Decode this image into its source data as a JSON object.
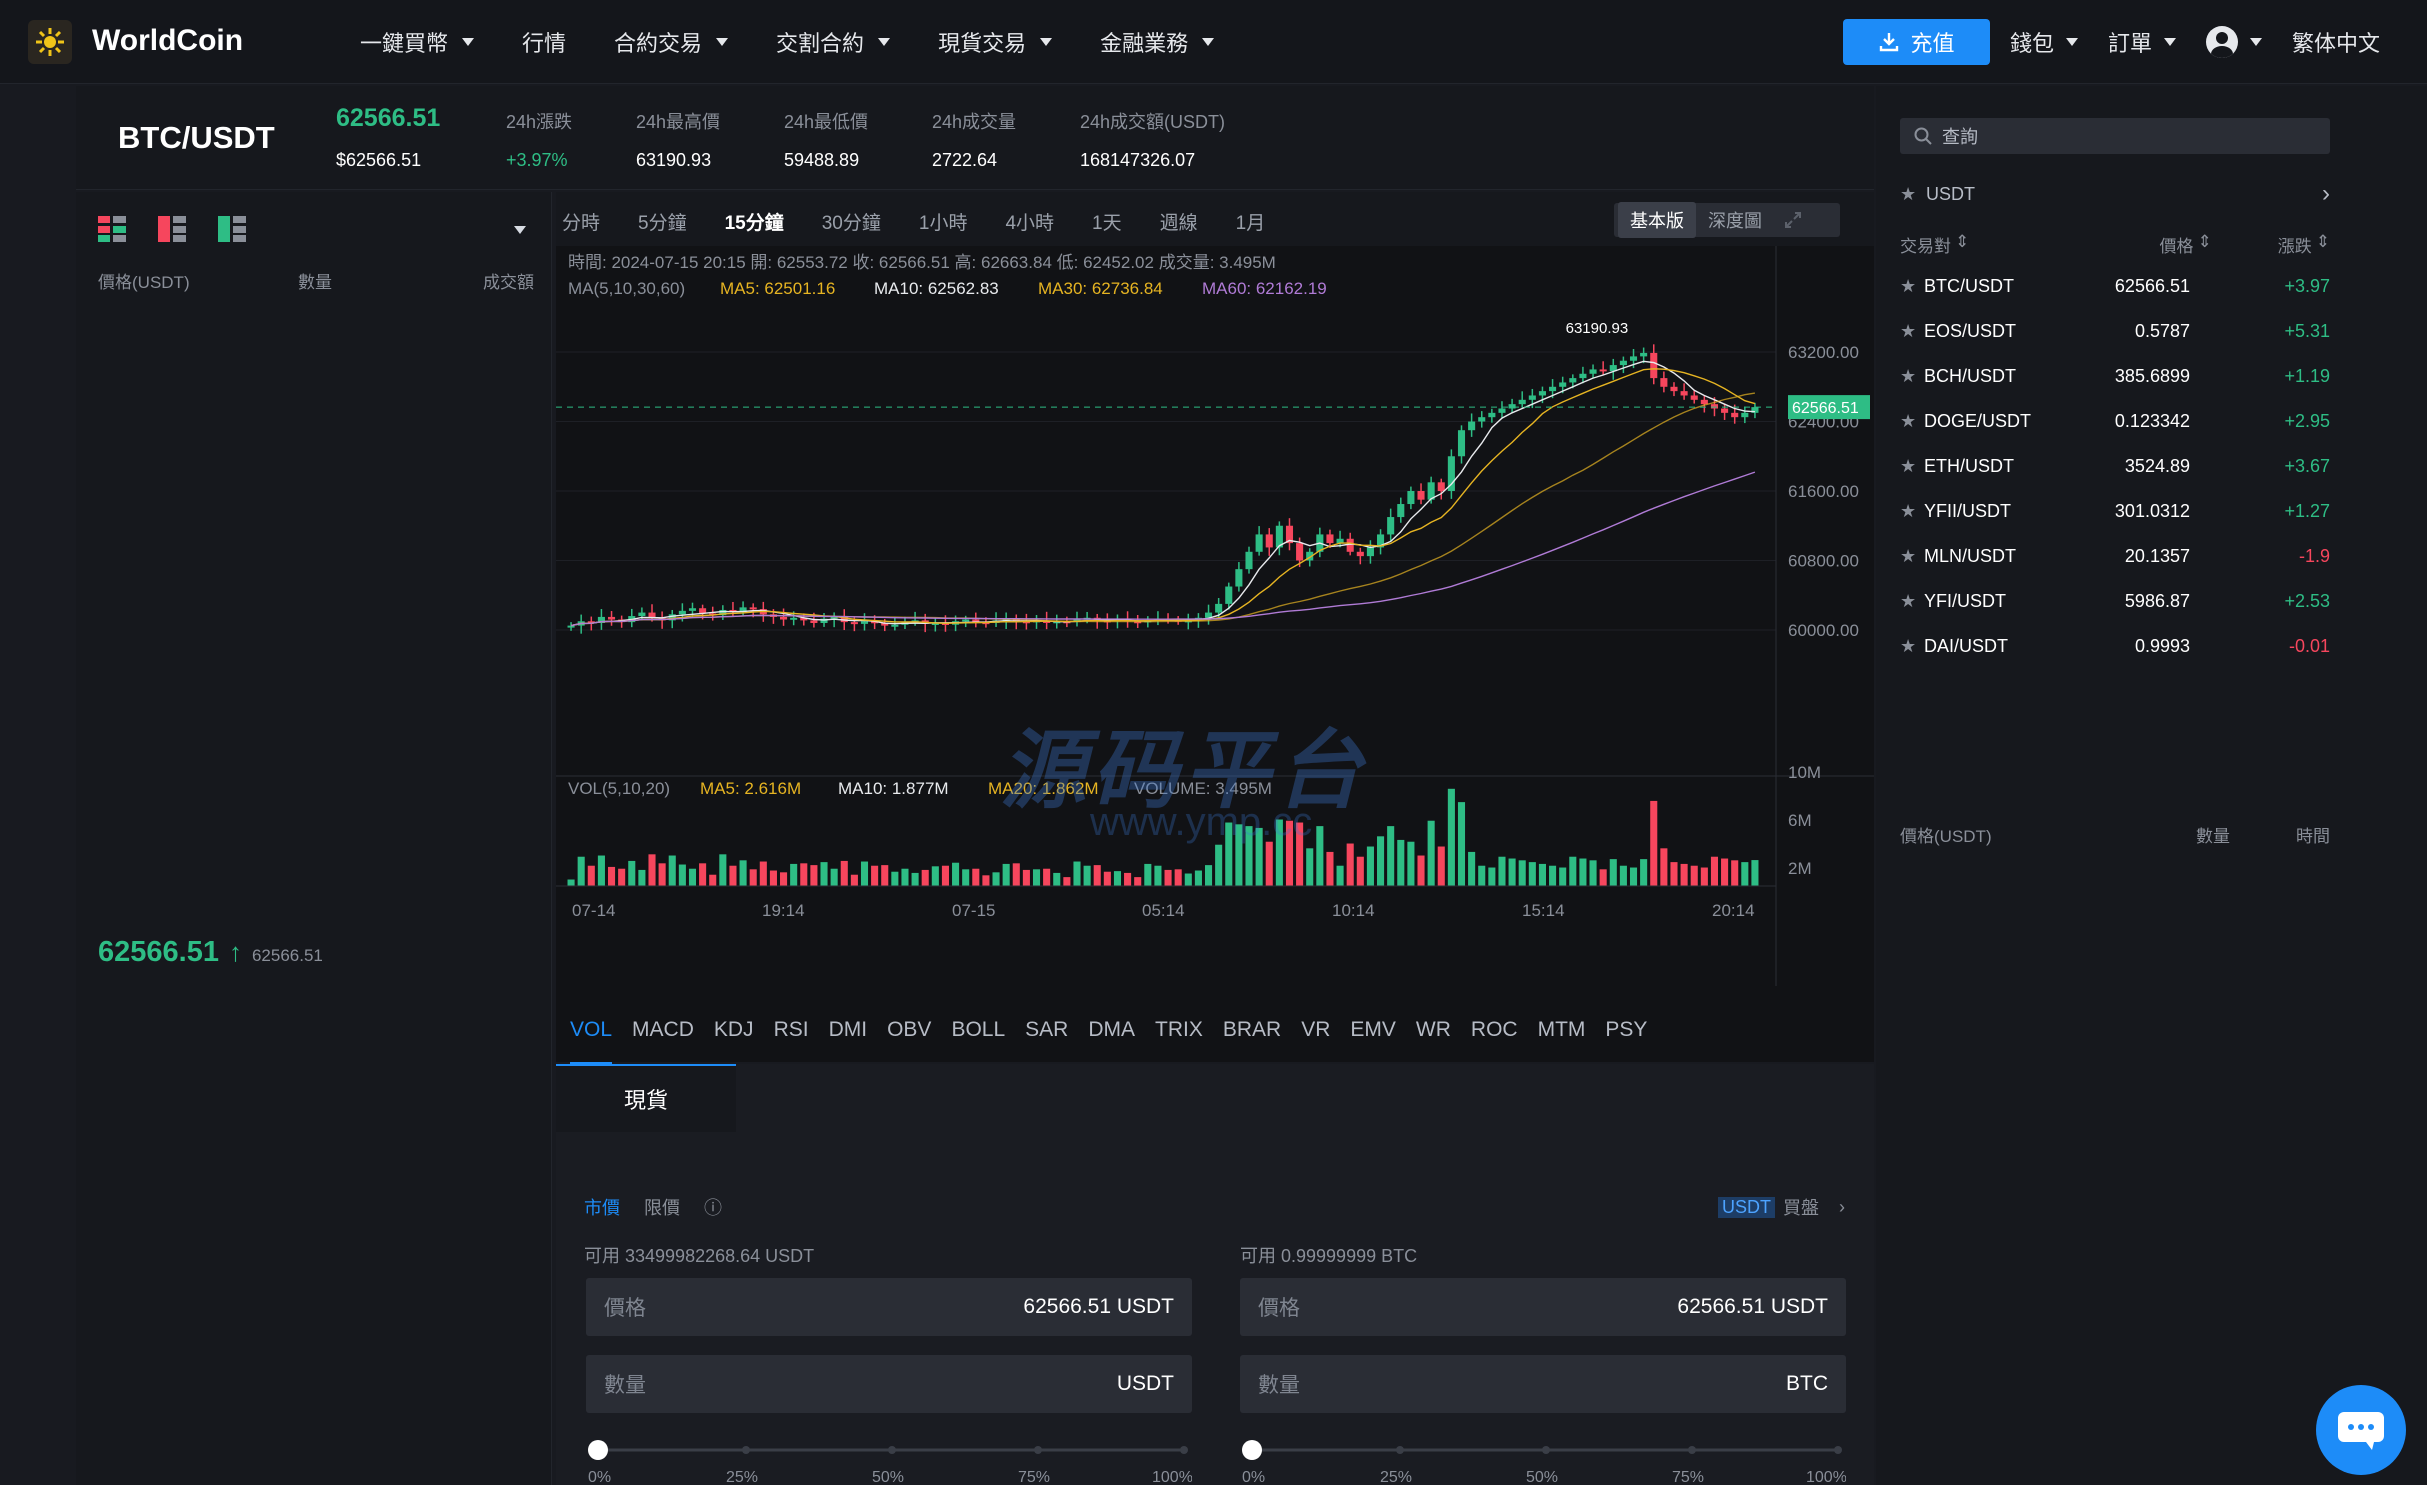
{
  "app": {
    "name": "WorldCoin"
  },
  "nav": [
    "一鍵買幣",
    "行情",
    "合約交易",
    "交割合約",
    "現貨交易",
    "金融業務"
  ],
  "nav_has_caret": [
    true,
    false,
    true,
    true,
    true,
    true
  ],
  "topright": {
    "deposit": "充值",
    "wallet": "錢包",
    "orders": "訂單",
    "language": "繁体中文"
  },
  "ticker": {
    "pair": "BTC/USDT",
    "last": "62566.51",
    "last_usd": "$62566.51",
    "change_label": "24h漲跌",
    "change": "+3.97%",
    "high_label": "24h最高價",
    "high": "63190.93",
    "low_label": "24h最低價",
    "low": "59488.89",
    "vol_label": "24h成交量",
    "vol": "2722.64",
    "amount_label": "24h成交額(USDT)",
    "amount": "168147326.07"
  },
  "orderbook": {
    "headers": [
      "價格(USDT)",
      "數量",
      "成交額"
    ],
    "last_price": "62566.51",
    "last_price_small": "62566.51"
  },
  "chart_toolbar": {
    "timeframes": [
      "分時",
      "5分鐘",
      "15分鐘",
      "30分鐘",
      "1小時",
      "4小時",
      "1天",
      "週線",
      "1月"
    ],
    "active": "15分鐘",
    "view_basic": "基本版",
    "view_depth": "深度圖"
  },
  "chart_info": {
    "line1": "時間: 2024-07-15 20:15    開: 62553.72    收: 62566.51    高: 62663.84    低: 62452.02    成交量: 3.495M",
    "ma_label": "MA(5,10,30,60)",
    "ma5": "MA5: 62501.16",
    "ma10": "MA10: 62562.83",
    "ma30": "MA30: 62736.84",
    "ma60": "MA60: 62162.19",
    "vol_label": "VOL(5,10,20)",
    "vma5": "MA5: 2.616M",
    "vma10": "MA10: 1.877M",
    "vma20": "MA20: 1.862M",
    "volume": "VOLUME: 3.495M",
    "high_marker": "63190.93",
    "current_marker": "62566.51"
  },
  "chart_data": {
    "type": "candlestick",
    "y_ticks": [
      "63200.00",
      "62400.00",
      "61600.00",
      "60800.00",
      "60000.00"
    ],
    "ylim": [
      59700,
      63500
    ],
    "x_ticks": [
      "07-14",
      "19:14",
      "07-15",
      "05:14",
      "10:14",
      "15:14",
      "20:14"
    ],
    "vol_ticks": [
      "10M",
      "6M",
      "2M"
    ],
    "close": [
      60050,
      60100,
      60080,
      60150,
      60120,
      60090,
      60160,
      60200,
      60140,
      60110,
      60180,
      60220,
      60250,
      60190,
      60170,
      60230,
      60210,
      60260,
      60240,
      60180,
      60150,
      60120,
      60140,
      60110,
      60080,
      60130,
      60160,
      60090,
      60070,
      60100,
      60080,
      60050,
      60060,
      60090,
      60110,
      60070,
      60080,
      60060,
      60100,
      60120,
      60090,
      60080,
      60110,
      60130,
      60100,
      60090,
      60110,
      60080,
      60100,
      60090,
      60120,
      60140,
      60110,
      60100,
      60120,
      60100,
      60090,
      60110,
      60130,
      60120,
      60100,
      60110,
      60140,
      60200,
      60300,
      60500,
      60700,
      60900,
      61100,
      60950,
      61200,
      61000,
      60800,
      60900,
      61100,
      61000,
      61050,
      60900,
      60850,
      60950,
      61100,
      61300,
      61450,
      61600,
      61500,
      61700,
      61600,
      62000,
      62300,
      62400,
      62450,
      62500,
      62550,
      62600,
      62650,
      62700,
      62750,
      62800,
      62850,
      62900,
      62950,
      63000,
      62980,
      63050,
      63100,
      63150,
      63190,
      62900,
      62800,
      62750,
      62700,
      62650,
      62600,
      62550,
      62500,
      62450,
      62500,
      62566
    ]
  },
  "indicators": [
    "VOL",
    "MACD",
    "KDJ",
    "RSI",
    "DMI",
    "OBV",
    "BOLL",
    "SAR",
    "DMA",
    "TRIX",
    "BRAR",
    "VR",
    "EMV",
    "WR",
    "ROC",
    "MTM",
    "PSY"
  ],
  "indicator_active": "VOL",
  "trade": {
    "tab": "現貨",
    "order_types": [
      "市價",
      "限價"
    ],
    "account": "USDT",
    "account_action": "買盤",
    "buy_available": "可用  33499982268.64 USDT",
    "sell_available": "可用  0.99999999 BTC",
    "price_label": "價格",
    "price_value": "62566.51  USDT",
    "qty_label": "數量",
    "buy_qty_unit": "USDT",
    "sell_qty_unit": "BTC",
    "slider_marks": [
      "0%",
      "25%",
      "50%",
      "75%",
      "100%"
    ]
  },
  "market": {
    "search_placeholder": "查詢",
    "tab": "USDT",
    "headers": [
      "交易對",
      "價格",
      "漲跌"
    ],
    "rows": [
      {
        "pair": "BTC/USDT",
        "price": "62566.51",
        "change": "+3.97",
        "up": true
      },
      {
        "pair": "EOS/USDT",
        "price": "0.5787",
        "change": "+5.31",
        "up": true
      },
      {
        "pair": "BCH/USDT",
        "price": "385.6899",
        "change": "+1.19",
        "up": true
      },
      {
        "pair": "DOGE/USDT",
        "price": "0.123342",
        "change": "+2.95",
        "up": true
      },
      {
        "pair": "ETH/USDT",
        "price": "3524.89",
        "change": "+3.67",
        "up": true
      },
      {
        "pair": "YFII/USDT",
        "price": "301.0312",
        "change": "+1.27",
        "up": true
      },
      {
        "pair": "MLN/USDT",
        "price": "20.1357",
        "change": "-1.9",
        "up": false
      },
      {
        "pair": "YFI/USDT",
        "price": "5986.87",
        "change": "+2.53",
        "up": true
      },
      {
        "pair": "DAI/USDT",
        "price": "0.9993",
        "change": "-0.01",
        "up": false
      }
    ],
    "trades_headers": [
      "價格(USDT)",
      "數量",
      "時間"
    ]
  },
  "watermark": {
    "text": "源码平台",
    "url": "www.ymp.cc"
  },
  "colors": {
    "up": "#2ebd85",
    "down": "#f6465d",
    "accent": "#1d8cf8"
  }
}
